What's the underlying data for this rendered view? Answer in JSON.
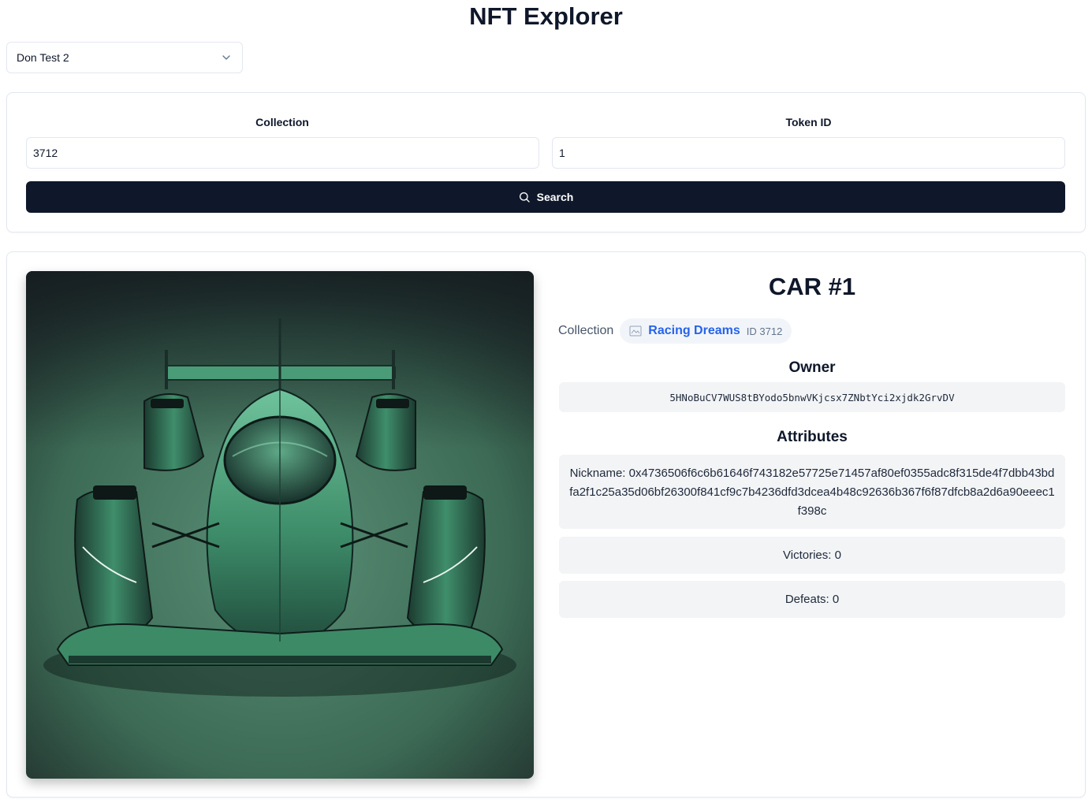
{
  "app": {
    "title": "NFT Explorer"
  },
  "account_select": {
    "selected": "Don Test 2"
  },
  "search": {
    "collection_label": "Collection",
    "collection_value": "3712",
    "token_label": "Token ID",
    "token_value": "1",
    "button_label": "Search"
  },
  "nft": {
    "name": "CAR #1",
    "collection_label": "Collection",
    "collection_name": "Racing Dreams",
    "collection_id": "ID 3712",
    "owner_title": "Owner",
    "owner_address": "5HNoBuCV7WUS8tBYodo5bnwVKjcsx7ZNbtYci2xjdk2GrvDV",
    "attributes_title": "Attributes",
    "attributes": [
      "Nickname: 0x4736506f6c6b61646f743182e57725e71457af80ef0355adc8f315de4f7dbb43bdfa2f1c25a35d06bf26300f841cf9c7b4236dfd3dcea4b48c92636b367f6f87dfcb8a2d6a90eeec1f398c",
      "Victories: 0",
      "Defeats: 0"
    ]
  },
  "colors": {
    "primary_button": "#0f172a",
    "link": "#2563eb",
    "car_green": "#3f8d6c",
    "image_background": "#4e7d66"
  },
  "icons": [
    "chevron-down-icon",
    "search-icon",
    "broken-image-icon"
  ]
}
